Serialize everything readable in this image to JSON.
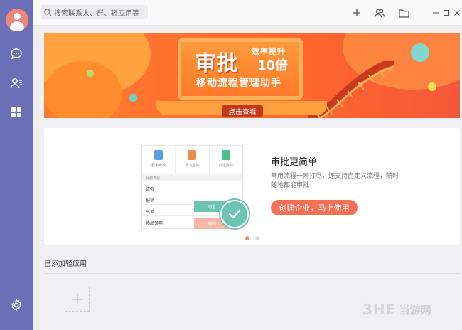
{
  "topbar": {
    "search_placeholder": "搜索联系人、群、轻应用等"
  },
  "banner": {
    "title": "审批",
    "kicker": "效率提升",
    "times": "10倍",
    "subtitle": "移动流程管理助手",
    "button": "点击查看"
  },
  "promo": {
    "title": "审批更简单",
    "description": "常用流程一网打尽，还支持自定义流程，随时随地都能审批",
    "cta": "创建企业，马上使用",
    "mockup": {
      "tabs": [
        "我审批的",
        "我发起的",
        "抄送我的"
      ],
      "section_header": "我要发起",
      "rows": [
        "请假",
        "报销",
        "出差",
        "物品领用"
      ],
      "approve": "同意",
      "reject": "退回"
    }
  },
  "apps_section": {
    "title": "已添加轻应用"
  },
  "watermark": {
    "logo": "3HE",
    "text": "当游网"
  },
  "colors": {
    "sidebar": "#6b6fb8",
    "accent": "#f47055",
    "teal": "#6cc3b3"
  }
}
